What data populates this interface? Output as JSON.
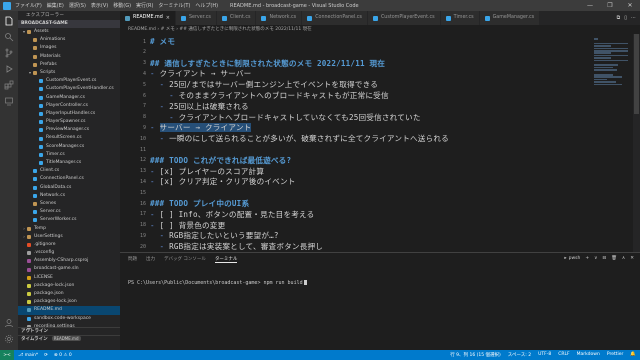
{
  "titlebar": {
    "menu": [
      "ファイル(F)",
      "編集(E)",
      "選択(S)",
      "表示(V)",
      "移動(G)",
      "実行(R)",
      "ターミナル(T)",
      "ヘルプ(H)"
    ],
    "title": "README.md - broadcast-game - Visual Studio Code",
    "controls": [
      "—",
      "❐",
      "✕"
    ]
  },
  "sidebar": {
    "title": "エクスプローラー",
    "folder": "BROADCAST-GAME",
    "items": [
      {
        "label": "Assets",
        "level": 1,
        "twisty": "▾",
        "color": "#c09553"
      },
      {
        "label": "Animations",
        "level": 2,
        "twisty": "",
        "color": "#c09553"
      },
      {
        "label": "Images",
        "level": 2,
        "twisty": "",
        "color": "#c09553"
      },
      {
        "label": "Materials",
        "level": 2,
        "twisty": "",
        "color": "#c09553"
      },
      {
        "label": "Prefabs",
        "level": 2,
        "twisty": "",
        "color": "#c09553"
      },
      {
        "label": "Scripts",
        "level": 2,
        "twisty": "▾",
        "color": "#c09553"
      },
      {
        "label": "CustomPlayerEvent.cs",
        "level": 3,
        "twisty": "",
        "color": "#3aa6ea"
      },
      {
        "label": "CustomPlayerEventHandler.cs",
        "level": 3,
        "twisty": "",
        "color": "#3aa6ea"
      },
      {
        "label": "GameManager.cs",
        "level": 3,
        "twisty": "",
        "color": "#3aa6ea"
      },
      {
        "label": "PlayerController.cs",
        "level": 3,
        "twisty": "",
        "color": "#3aa6ea"
      },
      {
        "label": "PlayerInputHandler.cs",
        "level": 3,
        "twisty": "",
        "color": "#3aa6ea"
      },
      {
        "label": "PlayerSpawner.cs",
        "level": 3,
        "twisty": "",
        "color": "#3aa6ea"
      },
      {
        "label": "PreviewManager.cs",
        "level": 3,
        "twisty": "",
        "color": "#3aa6ea"
      },
      {
        "label": "ResultScreen.cs",
        "level": 3,
        "twisty": "",
        "color": "#3aa6ea"
      },
      {
        "label": "ScoreManager.cs",
        "level": 3,
        "twisty": "",
        "color": "#3aa6ea"
      },
      {
        "label": "Timer.cs",
        "level": 3,
        "twisty": "",
        "color": "#3aa6ea"
      },
      {
        "label": "TitleManager.cs",
        "level": 3,
        "twisty": "",
        "color": "#3aa6ea"
      },
      {
        "label": "Client.cs",
        "level": 2,
        "twisty": "",
        "color": "#3aa6ea"
      },
      {
        "label": "ConnectionPanel.cs",
        "level": 2,
        "twisty": "",
        "color": "#3aa6ea"
      },
      {
        "label": "GlobalData.cs",
        "level": 2,
        "twisty": "",
        "color": "#3aa6ea"
      },
      {
        "label": "Network.cs",
        "level": 2,
        "twisty": "",
        "color": "#3aa6ea"
      },
      {
        "label": "Scenes",
        "level": 2,
        "twisty": "",
        "color": "#c09553"
      },
      {
        "label": "Server.cs",
        "level": 2,
        "twisty": "",
        "color": "#3aa6ea"
      },
      {
        "label": "ServerWorker.cs",
        "level": 2,
        "twisty": "",
        "color": "#3aa6ea"
      },
      {
        "label": "Temp",
        "level": 1,
        "twisty": "›",
        "color": "#c09553"
      },
      {
        "label": "UserSettings",
        "level": 1,
        "twisty": "›",
        "color": "#c09553"
      },
      {
        "label": ".gitignore",
        "level": 1,
        "twisty": "",
        "color": "#e44d26"
      },
      {
        "label": ".vsconfig",
        "level": 1,
        "twisty": "",
        "color": "#9e9e9e"
      },
      {
        "label": "Assembly-CSharp.csproj",
        "level": 1,
        "twisty": "",
        "color": "#9b4f96"
      },
      {
        "label": "broadcast-game.sln",
        "level": 1,
        "twisty": "",
        "color": "#9b4f96"
      },
      {
        "label": "LICENSE",
        "level": 1,
        "twisty": "",
        "color": "#d4a017"
      },
      {
        "label": "package-lock.json",
        "level": 1,
        "twisty": "",
        "color": "#cbcb41"
      },
      {
        "label": "package.json",
        "level": 1,
        "twisty": "",
        "color": "#cbcb41"
      },
      {
        "label": "packages-lock.json",
        "level": 1,
        "twisty": "",
        "color": "#cbcb41"
      },
      {
        "label": "README.md",
        "level": 1,
        "twisty": "",
        "color": "#519aba",
        "selected": true
      },
      {
        "label": "sandbox.code-workspace",
        "level": 1,
        "twisty": "",
        "color": "#3aa6ea"
      },
      {
        "label": "recording.settings",
        "level": 1,
        "twisty": "",
        "color": "#9e9e9e"
      }
    ],
    "outline": "アウトライン",
    "timeline": "タイムライン",
    "timeline_badge": "README.md"
  },
  "tabs": [
    {
      "label": "README.md",
      "active": true,
      "color": "#519aba"
    },
    {
      "label": "Server.cs",
      "active": false,
      "color": "#3aa6ea"
    },
    {
      "label": "Client.cs",
      "active": false,
      "color": "#3aa6ea"
    },
    {
      "label": "Network.cs",
      "active": false,
      "color": "#3aa6ea"
    },
    {
      "label": "ConnectionPanel.cs",
      "active": false,
      "color": "#3aa6ea"
    },
    {
      "label": "CustomPlayerEvent.cs",
      "active": false,
      "color": "#3aa6ea"
    },
    {
      "label": "Timer.cs",
      "active": false,
      "color": "#3aa6ea"
    },
    {
      "label": "GameManager.cs",
      "active": false,
      "color": "#3aa6ea"
    }
  ],
  "tab_actions": [
    "⧉",
    "▯",
    "⋯"
  ],
  "breadcrumb": "README.md › # メモ › ## 通信しすぎたときに制限された状態のメモ 2022/11/11 現在",
  "editor": {
    "lines": [
      {
        "n": "1",
        "parts": [
          {
            "t": "# メモ",
            "c": "hd"
          }
        ]
      },
      {
        "n": "2",
        "parts": []
      },
      {
        "n": "3",
        "parts": [
          {
            "t": "## 通信しすぎたときに制限された状態のメモ 2022/11/11 現在",
            "c": "hd"
          }
        ]
      },
      {
        "n": "4",
        "parts": [
          {
            "t": "- ",
            "c": "li"
          },
          {
            "t": "クライアント → サーバー",
            "c": ""
          }
        ]
      },
      {
        "n": "5",
        "parts": [
          {
            "t": "  ",
            "c": "gd"
          },
          {
            "t": "- ",
            "c": "li"
          },
          {
            "t": "25回/まではサーバー側エンジン上でイベントを取得できる",
            "c": ""
          }
        ]
      },
      {
        "n": "6",
        "parts": [
          {
            "t": "    ",
            "c": "gd"
          },
          {
            "t": "- ",
            "c": "li"
          },
          {
            "t": "そのままクライアントへのブロードキャストもが正常に受信",
            "c": ""
          }
        ]
      },
      {
        "n": "7",
        "parts": [
          {
            "t": "  ",
            "c": "gd"
          },
          {
            "t": "- ",
            "c": "li"
          },
          {
            "t": "25回以上は破棄される",
            "c": ""
          }
        ]
      },
      {
        "n": "8",
        "parts": [
          {
            "t": "    ",
            "c": "gd"
          },
          {
            "t": "- ",
            "c": "li"
          },
          {
            "t": "クライアントへブロードキャストしていなくても25回受信されていた",
            "c": ""
          }
        ]
      },
      {
        "n": "9",
        "parts": [
          {
            "t": "- ",
            "c": "li"
          },
          {
            "t": "サーバー → クライアント",
            "c": "hlsel"
          }
        ]
      },
      {
        "n": "10",
        "parts": [
          {
            "t": "  ",
            "c": "gd"
          },
          {
            "t": "- ",
            "c": "li"
          },
          {
            "t": "一瞬のにして送られることが多いが、破棄されずに全てクライアントへ送られる",
            "c": ""
          }
        ]
      },
      {
        "n": "11",
        "parts": []
      },
      {
        "n": "12",
        "parts": [
          {
            "t": "### TODO これができれば最低遊べる?",
            "c": "hd"
          }
        ]
      },
      {
        "n": "13",
        "parts": [
          {
            "t": "- ",
            "c": "li"
          },
          {
            "t": "[x] プレイヤーのスコア計算",
            "c": ""
          }
        ]
      },
      {
        "n": "14",
        "parts": [
          {
            "t": "- ",
            "c": "li"
          },
          {
            "t": "[x] クリア判定・クリア後のイベント",
            "c": ""
          }
        ]
      },
      {
        "n": "15",
        "parts": []
      },
      {
        "n": "16",
        "parts": [
          {
            "t": "### TODO プレイ中のUI系",
            "c": "hd"
          }
        ]
      },
      {
        "n": "17",
        "parts": [
          {
            "t": "- ",
            "c": "li"
          },
          {
            "t": "[ ] Info、ボタンの配置・見た目を考える",
            "c": ""
          }
        ]
      },
      {
        "n": "18",
        "parts": [
          {
            "t": "- ",
            "c": "li"
          },
          {
            "t": "[ ] 背景色の変更",
            "c": ""
          }
        ]
      },
      {
        "n": "19",
        "parts": [
          {
            "t": "  ",
            "c": "gd"
          },
          {
            "t": "- ",
            "c": "li"
          },
          {
            "t": "RGB指定したいという要望が…?",
            "c": ""
          }
        ]
      },
      {
        "n": "20",
        "parts": [
          {
            "t": "  ",
            "c": "gd"
          },
          {
            "t": "- ",
            "c": "li"
          },
          {
            "t": "RGB指定は実装案として、審査ボタン長押し",
            "c": ""
          }
        ]
      }
    ]
  },
  "panel": {
    "tabs": [
      "問題",
      "出力",
      "デバッグ コンソール",
      "ターミナル"
    ],
    "active_tab": 3,
    "shell": "pwsh",
    "actions": [
      "+",
      "∨",
      "⊟",
      "🗑",
      "∧",
      "✕"
    ],
    "prompt": "PS C:\\Users\\Public\\Documents\\broadcast-game> npm run build"
  },
  "statusbar": {
    "remote": "><",
    "left": [
      "⎇ main*",
      "⟳",
      "⊗ 0  ⚠ 0"
    ],
    "right": [
      "行 9、列 16 (15 個選択)",
      "スペース: 2",
      "UTF-8",
      "CRLF",
      "Markdown",
      "Prettier",
      "🔔"
    ]
  },
  "activity_icons": [
    "files-icon",
    "search-icon",
    "source-control-icon",
    "run-debug-icon",
    "extensions-icon",
    "remote-explorer-icon",
    "account-icon",
    "settings-gear-icon"
  ]
}
